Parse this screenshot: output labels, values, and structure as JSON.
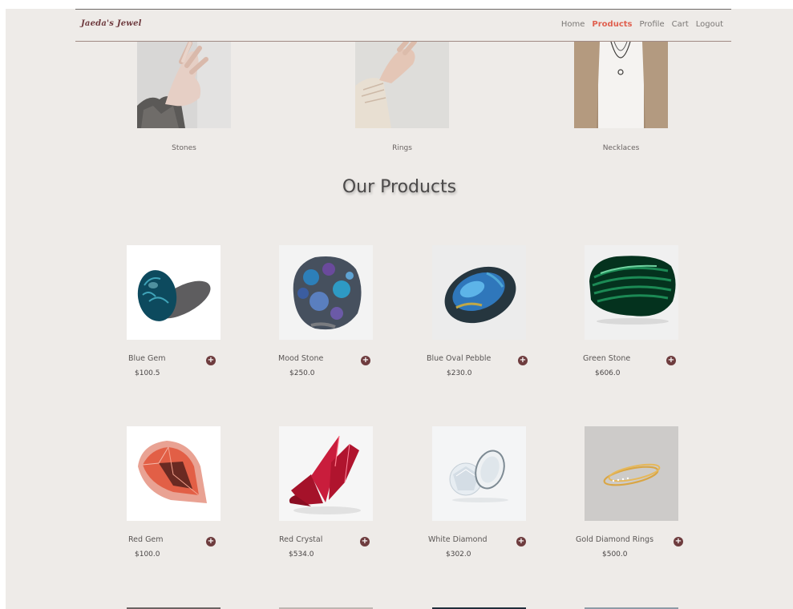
{
  "nav": {
    "logo": "Jaeda's Jewel",
    "links": [
      {
        "label": "Home",
        "active": false
      },
      {
        "label": "Products",
        "active": true
      },
      {
        "label": "Profile",
        "active": false
      },
      {
        "label": "Cart",
        "active": false
      },
      {
        "label": "Logout",
        "active": false
      }
    ]
  },
  "categories": [
    {
      "label": "Stones"
    },
    {
      "label": "Rings"
    },
    {
      "label": "Necklaces"
    }
  ],
  "section_title": "Our Products",
  "products": [
    {
      "name": "Blue Gem",
      "price": "$100.5"
    },
    {
      "name": "Mood Stone",
      "price": "$250.0"
    },
    {
      "name": "Blue Oval Pebble",
      "price": "$230.0"
    },
    {
      "name": "Green Stone",
      "price": "$606.0"
    },
    {
      "name": "Red Gem",
      "price": "$100.0"
    },
    {
      "name": "Red Crystal",
      "price": "$534.0"
    },
    {
      "name": "White Diamond",
      "price": "$302.0"
    },
    {
      "name": "Gold Diamond Rings",
      "price": "$500.0"
    }
  ],
  "icons": {
    "add": "plus-circle-icon"
  },
  "colors": {
    "accent": "#e0604f",
    "brand": "#6e3c3e",
    "background": "#eeebe8"
  }
}
